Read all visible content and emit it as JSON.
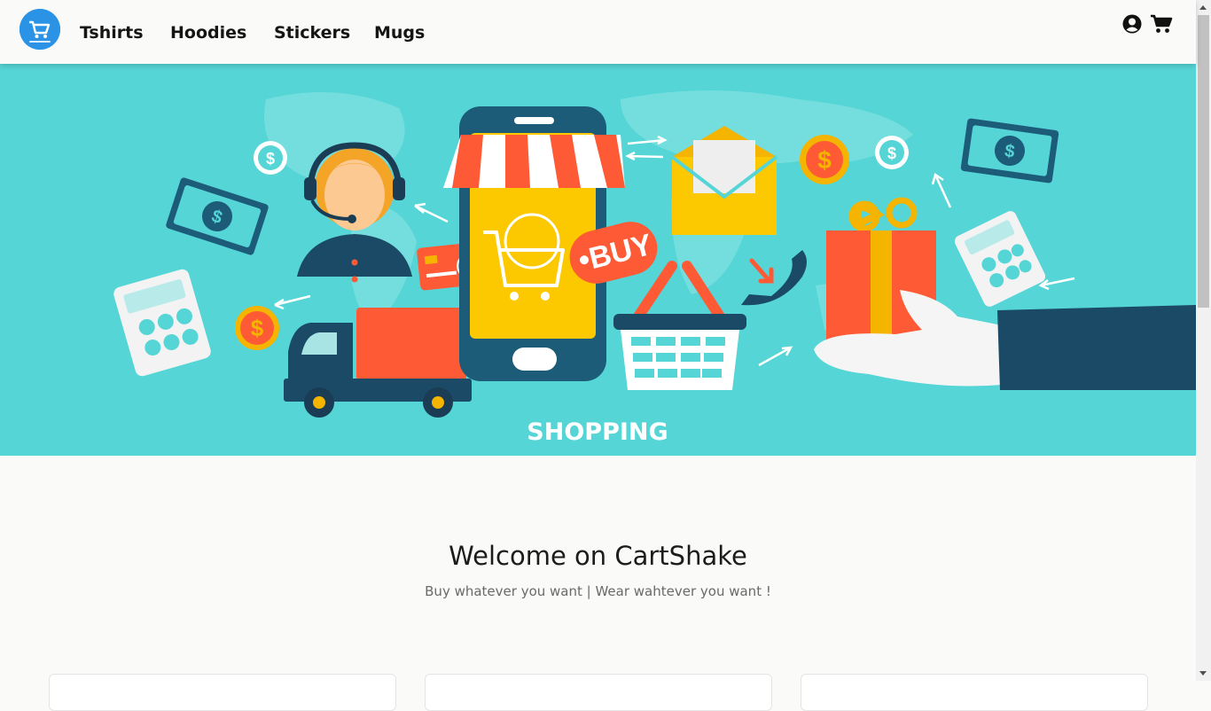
{
  "nav": {
    "logo_icon": "shopping-cart-logo",
    "items": [
      {
        "label": "Tshirts"
      },
      {
        "label": "Hoodies"
      },
      {
        "label": "Stickers"
      },
      {
        "label": "Mugs"
      }
    ],
    "icons": [
      "user-circle-icon",
      "cart-icon"
    ]
  },
  "hero": {
    "caption": "SHOPPING",
    "buy_tag": "BUY",
    "background_color": "#55d5d6"
  },
  "welcome": {
    "title": "Welcome on CartShake",
    "subtitle": "Buy whatever you want | Wear wahtever you want !"
  }
}
